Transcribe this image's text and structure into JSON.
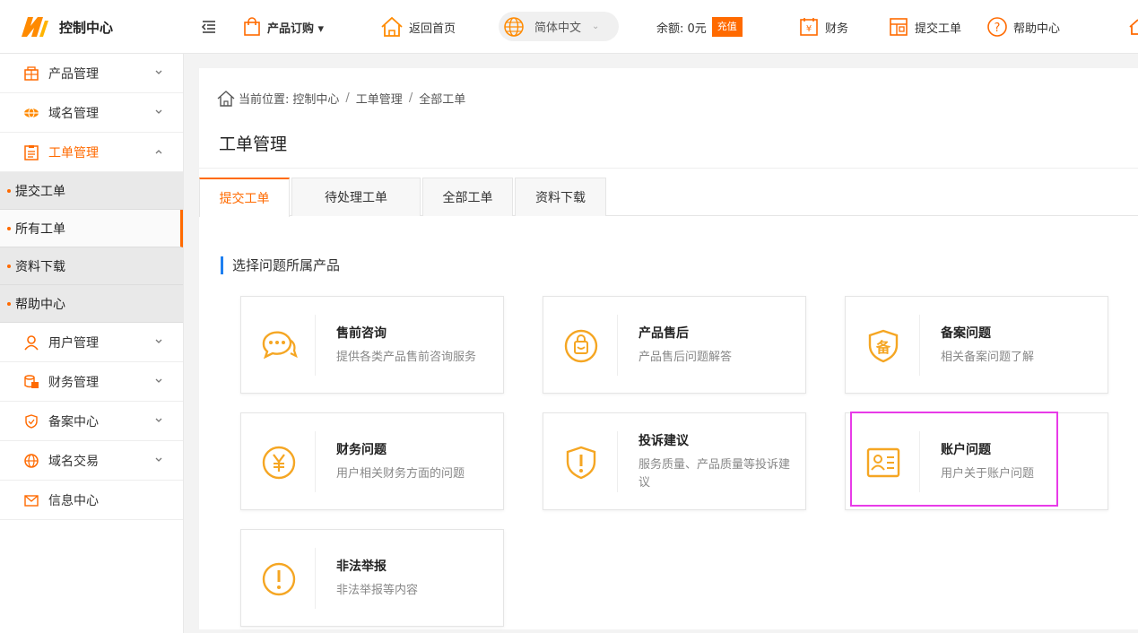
{
  "logo": {
    "text": "控制中心"
  },
  "topbar": {
    "menu_toggle_icon": "menu-fold-icon",
    "order_label": "产品订购 ▾",
    "home_label": "返回首页",
    "language": {
      "value": "简体中文",
      "caret": "⌄"
    },
    "balance": "余额: 0元",
    "recharge_label": "充值",
    "finance_label": "财务",
    "ticket_label": "提交工单",
    "help_label": "帮助中心"
  },
  "sidebar": {
    "items": [
      {
        "label": "产品管理",
        "icon": "product-icon"
      },
      {
        "label": "域名管理",
        "icon": "domain-icon"
      },
      {
        "label": "工单管理",
        "icon": "ticket-icon",
        "expanded": true
      }
    ],
    "subitems": [
      {
        "label": "提交工单"
      },
      {
        "label": "所有工单",
        "current": true
      },
      {
        "label": "资料下载"
      },
      {
        "label": "帮助中心"
      }
    ],
    "items_after": [
      {
        "label": "用户管理",
        "icon": "user-icon"
      },
      {
        "label": "财务管理",
        "icon": "finance-icon"
      },
      {
        "label": "备案中心",
        "icon": "shield-icon"
      },
      {
        "label": "域名交易",
        "icon": "globe-icon"
      },
      {
        "label": "信息中心",
        "icon": "mail-icon"
      }
    ]
  },
  "breadcrumb": {
    "prefix": "当前位置:",
    "items": [
      "控制中心",
      "工单管理",
      "全部工单"
    ],
    "sep": "/"
  },
  "page_title": "工单管理",
  "tabs": [
    {
      "label": "提交工单",
      "active": true
    },
    {
      "label": "待处理工单"
    },
    {
      "label": "全部工单"
    },
    {
      "label": "资料下载"
    }
  ],
  "section_title": "选择问题所属产品",
  "cards": [
    {
      "title": "售前咨询",
      "desc": "提供各类产品售前咨询服务",
      "icon": "chat-icon"
    },
    {
      "title": "产品售后",
      "desc": "产品售后问题解答",
      "icon": "bag-icon"
    },
    {
      "title": "备案问题",
      "desc": "相关备案问题了解",
      "icon": "beian-shield-icon"
    },
    {
      "title": "财务问题",
      "desc": "用户相关财务方面的问题",
      "icon": "yuan-icon"
    },
    {
      "title": "投诉建议",
      "desc": "服务质量、产品质量等投诉建议",
      "icon": "complaint-shield-icon"
    },
    {
      "title": "账户问题",
      "desc": "用户关于账户问题",
      "icon": "account-card-icon"
    },
    {
      "title": "非法举报",
      "desc": "非法举报等内容",
      "icon": "alert-icon"
    }
  ],
  "colors": {
    "accent": "#ff6a00",
    "icon": "#f5a623",
    "highlight": "#e83be8",
    "section_bar": "#1e7ff0"
  }
}
